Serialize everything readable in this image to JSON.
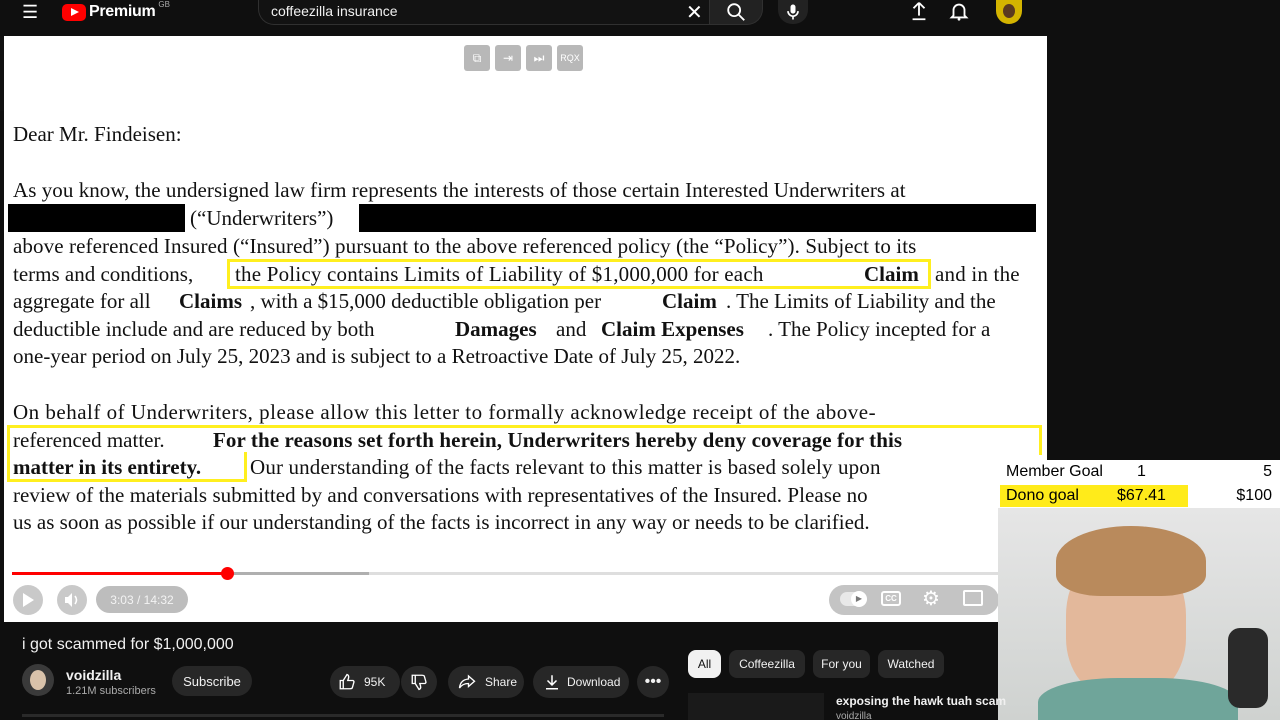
{
  "header": {
    "logo_text": "Premium",
    "logo_region": "GB",
    "search_query": "coffeezilla insurance",
    "icons": [
      "menu-icon",
      "close-icon",
      "search-icon",
      "mic-icon",
      "upload-icon",
      "bell-icon",
      "avatar"
    ]
  },
  "pdf_toolbar": {
    "ocr_label": "RQX"
  },
  "letter": {
    "salutation": "Dear Mr. Findeisen:",
    "p1": {
      "l1": "As you know, the undersigned law firm represents the interests of those certain Interested Underwriters at",
      "l2": "(“Underwriters”)",
      "l3": "above referenced Insured (“Insured”) pursuant to the above referenced policy (the “Policy”). Subject to its",
      "l4a": "terms and conditions,",
      "l4b": "the Policy contains Limits of Liability of $1,000,000 for each",
      "l4c": "Claim",
      "l4d": "and in the",
      "l5a": "aggregate for all",
      "l5b": "Claims",
      "l5c": ", with a $15,000 deductible obligation per",
      "l5d": "Claim",
      "l5e": ". The Limits of Liability and the",
      "l6a": "deductible include and are reduced by both",
      "l6b": "Damages",
      "l6c": "and",
      "l6d": "Claim Expenses",
      "l6e": ". The Policy incepted for a",
      "l7": "one-year period on July 25, 2023 and is subject to a Retroactive Date of July 25, 2022."
    },
    "p2": {
      "l1": "On behalf of Underwriters, please allow this letter to formally acknowledge receipt of the above-",
      "l2a": "referenced matter.",
      "l2b": "For the reasons set forth herein, Underwriters hereby deny coverage for this",
      "l3a": "matter in its entirety.",
      "l3b": "Our understanding of the facts relevant to this matter is based solely upon",
      "l4": "review of the materials submitted by and conversations with representatives of the Insured.  Please no",
      "l5": "us as soon as possible if our understanding of the facts is incorrect in any way or needs to be clarified."
    }
  },
  "player": {
    "time": "3:03 / 14:32",
    "progress_fraction": 0.21
  },
  "overlay": {
    "member_goal_label": "Member Goal",
    "member_goal_current": "1",
    "member_goal_target": "5",
    "dono_goal_label": "Dono goal",
    "dono_goal_current": "$67.41",
    "dono_goal_target": "$100",
    "dono_fraction": 0.674
  },
  "video": {
    "title": "i got scammed for $1,000,000",
    "channel": "voidzilla",
    "subscribers": "1.21M subscribers",
    "subscribe_label": "Subscribe",
    "likes": "95K",
    "share_label": "Share",
    "download_label": "Download"
  },
  "recommendations": {
    "chips": [
      "All",
      "Coffeezilla",
      "For you",
      "Watched"
    ],
    "first_title": "exposing the hawk tuah scam",
    "first_channel": "voidzilla"
  }
}
